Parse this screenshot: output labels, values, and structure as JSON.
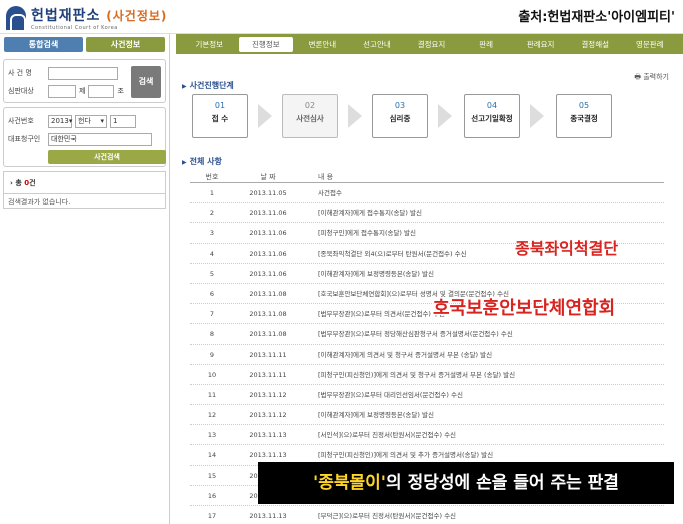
{
  "header": {
    "logo_title": "헌법재판소",
    "logo_sub": "(사건정보)",
    "logo_eng": "Constitutional Court of Korea",
    "source": "출처:헌법재판소'아이엠피티'"
  },
  "sidebar": {
    "tabs": [
      "통합검색",
      "사건정보"
    ],
    "case_name_label": "사 건 명",
    "target_label": "심판대상",
    "article_label": "제",
    "clause_label": "조",
    "search_button": "검색",
    "case_no_label": "사건번호",
    "case_year": "2013",
    "case_type": "헌다",
    "case_seq": "1",
    "representative_label": "대표청구인",
    "representative_value": "대한민국",
    "case_search_button": "사건검색",
    "count_prefix": "총 ",
    "count_value": "0",
    "count_suffix": "건",
    "result_message": "검색결과가 없습니다."
  },
  "menu": {
    "items": [
      "기본정보",
      "진행정보",
      "변론안내",
      "선고안내",
      "결정요지",
      "판례",
      "판례요지",
      "결정해설",
      "영문판례"
    ],
    "active_index": 1
  },
  "content": {
    "print_label": "출력하기",
    "progress_title": "사건진행단계",
    "steps": [
      {
        "num": "01",
        "name": "접 수",
        "done": true
      },
      {
        "num": "02",
        "name": "사전심사",
        "done": false
      },
      {
        "num": "03",
        "name": "심리중",
        "done": true
      },
      {
        "num": "04",
        "name": "선고기일확정",
        "done": true
      },
      {
        "num": "05",
        "name": "종국결정",
        "done": true
      }
    ],
    "all_title": "전체 사항",
    "columns": [
      "번호",
      "날 짜",
      "내 용"
    ],
    "rows": [
      [
        "1",
        "2013.11.05",
        "사건접수"
      ],
      [
        "2",
        "2013.11.06",
        "[이해관계자]에게 접수통지(송달) 발신"
      ],
      [
        "3",
        "2013.11.06",
        "[피청구인]에게 접수통지(송달) 발신"
      ],
      [
        "4",
        "2013.11.06",
        "[종북좌익척결단 외4(으)로부터 탄원서(문건접수) 수신"
      ],
      [
        "5",
        "2013.11.06",
        "[이해관계자]에게 보정명령등본(송달) 발신"
      ],
      [
        "6",
        "2013.11.08",
        "[호국보훈안보단체연합회](으)로부터 성명서 및 결의문(문건접수) 수신"
      ],
      [
        "7",
        "2013.11.08",
        "[법무부장관](으)로부터 의견서(문건접수) 수신"
      ],
      [
        "8",
        "2013.11.08",
        "[법무부장관](으)로부터 정당해산심판청구서 증거설명서(문건접수) 수신"
      ],
      [
        "9",
        "2013.11.11",
        "[이해관계자]에게 의견서 및 청구서 증거설명서 부본 (송달) 발신"
      ],
      [
        "10",
        "2013.11.11",
        "[피청구인(피신청인)]에게 의견서 및 청구서 증거설명서 부본 (송달) 발신"
      ],
      [
        "11",
        "2013.11.12",
        "[법무부장관](으)로부터 대리인선임서(문건접수) 수신"
      ],
      [
        "12",
        "2013.11.12",
        "[이해관계자]에게 보정명령등본(송달) 발신"
      ],
      [
        "13",
        "2013.11.13",
        "[서인석](으)로부터 진정서(탄원서)(문건접수) 수신"
      ],
      [
        "14",
        "2013.11.13",
        "[피청구인(피신청인)]에게 의견서 및 추가 증거설명서(송달) 발신"
      ],
      [
        "15",
        "2013.11.13",
        ""
      ],
      [
        "16",
        "2013.11.13",
        ""
      ],
      [
        "17",
        "2013.11.13",
        "[부덕근](으)로부터 진정서(탄원서)(문건접수) 수신"
      ]
    ]
  },
  "overlays": {
    "label1": "종북좌익척결단",
    "label2": "호국보훈안보단체연합회",
    "caption_hl": "'종북몰이'",
    "caption_rest": "의 정당성에 손을 들어 주는 판결"
  }
}
